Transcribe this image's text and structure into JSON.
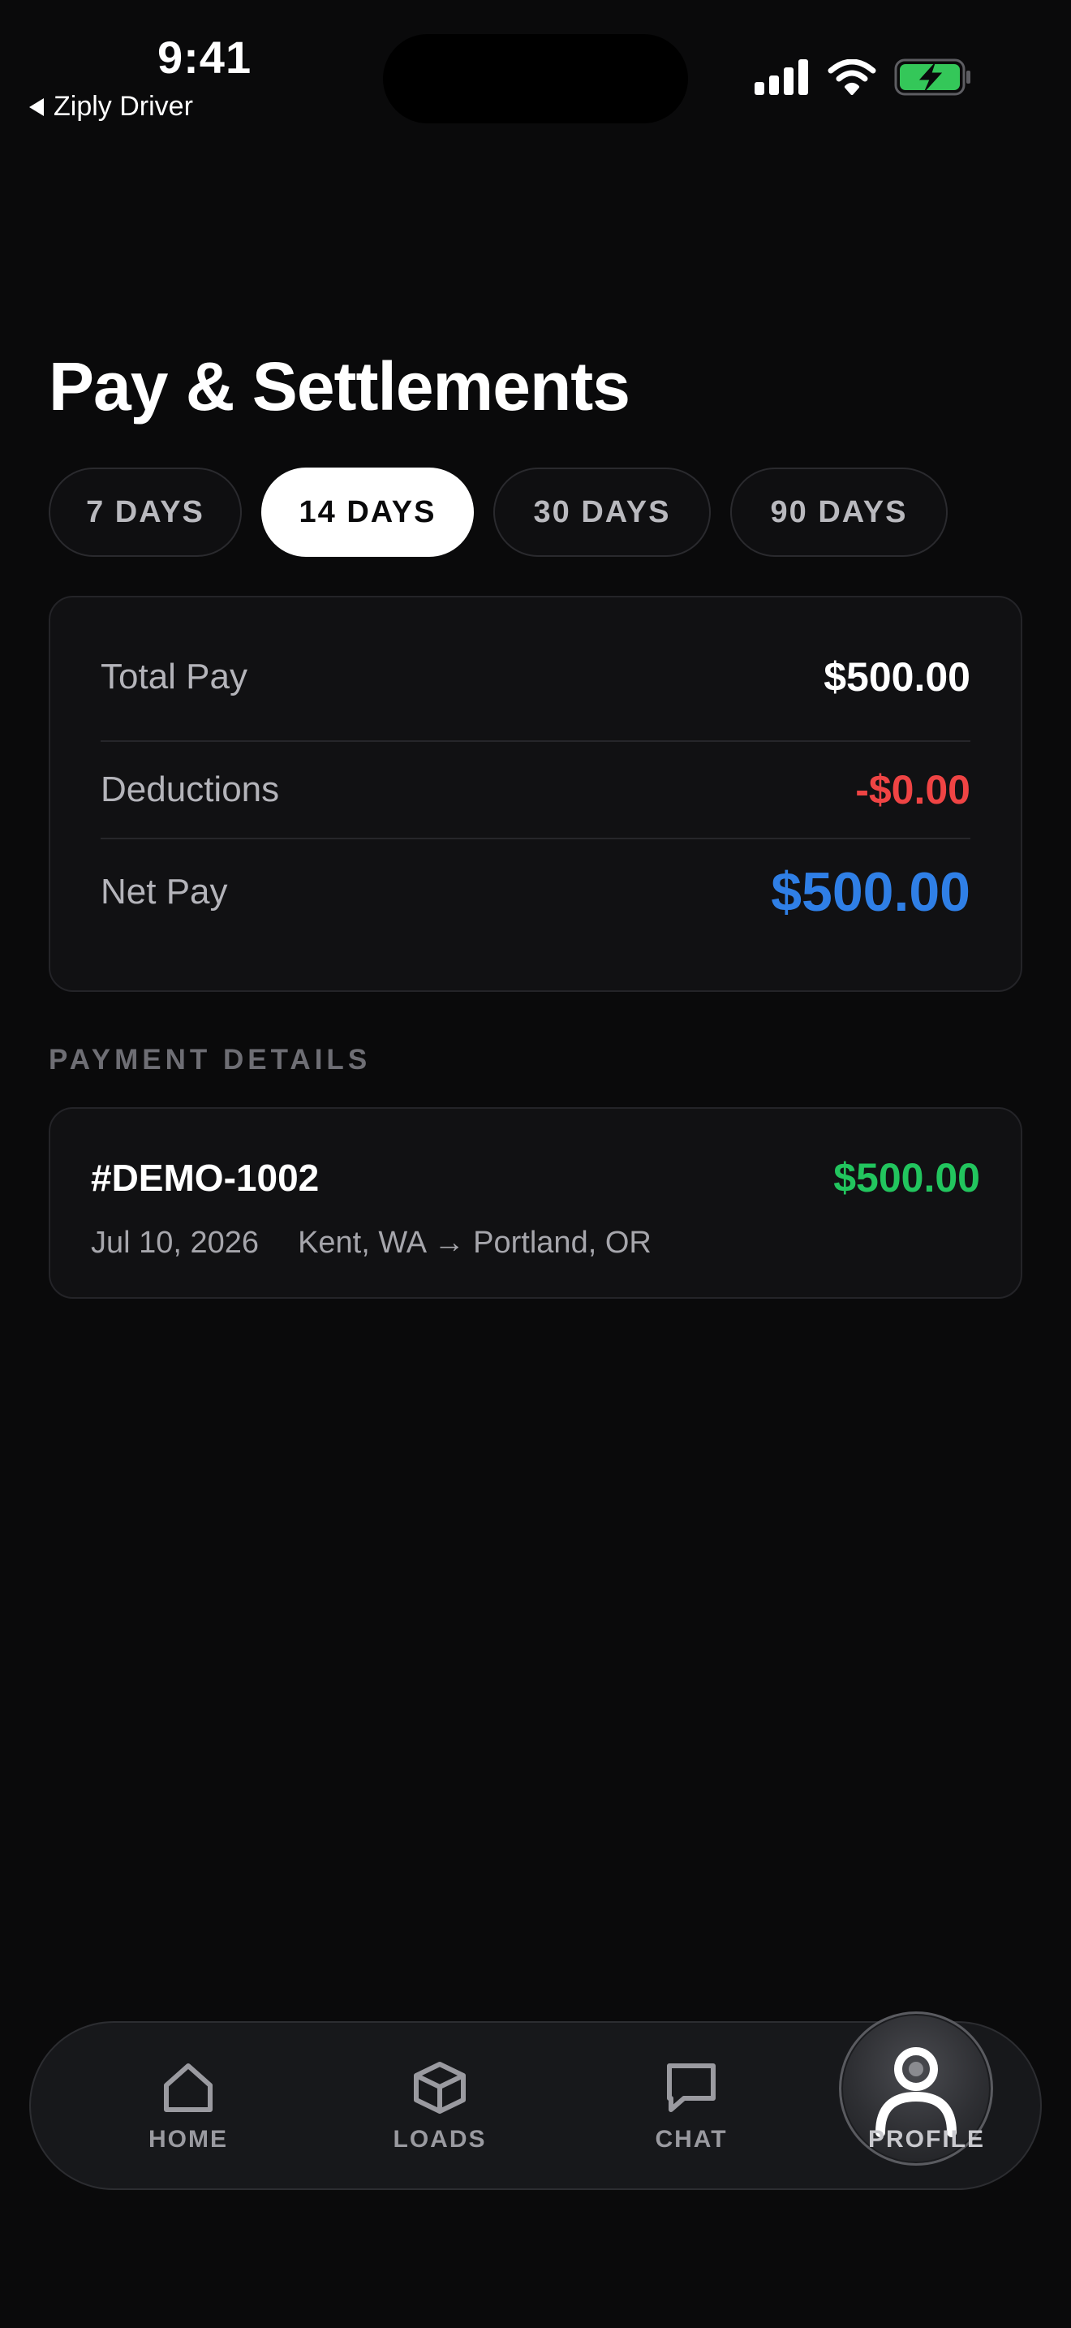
{
  "status_bar": {
    "time": "9:41",
    "back_app": "Ziply Driver",
    "icons": [
      "signal-icon",
      "wifi-icon",
      "battery-charging-icon"
    ]
  },
  "page": {
    "title": "Pay & Settlements"
  },
  "filters": {
    "options": [
      "7 DAYS",
      "14 DAYS",
      "30 DAYS",
      "90 DAYS"
    ],
    "selected": "14 DAYS"
  },
  "summary": {
    "total_pay_label": "Total Pay",
    "total_pay_value": "$500.00",
    "deductions_label": "Deductions",
    "deductions_value": "-$0.00",
    "net_pay_label": "Net Pay",
    "net_pay_value": "$500.00"
  },
  "payment_details": {
    "header": "PAYMENT DETAILS",
    "items": [
      {
        "id": "#DEMO-1002",
        "amount": "$500.00",
        "date": "Jul 10, 2026",
        "route": "Kent, WA → Portland, OR"
      }
    ]
  },
  "tab_bar": {
    "items": [
      {
        "label": "HOME",
        "icon": "home-icon"
      },
      {
        "label": "LOADS",
        "icon": "box-icon"
      },
      {
        "label": "CHAT",
        "icon": "chat-icon"
      },
      {
        "label": "PROFILE",
        "icon": "user-icon"
      }
    ],
    "active": "PROFILE"
  },
  "colors": {
    "background": "#0a0a0b",
    "card": "#111113",
    "negative": "#ef4444",
    "net_pay": "#2f7fe6",
    "positive": "#22c55e",
    "battery": "#34c759"
  }
}
